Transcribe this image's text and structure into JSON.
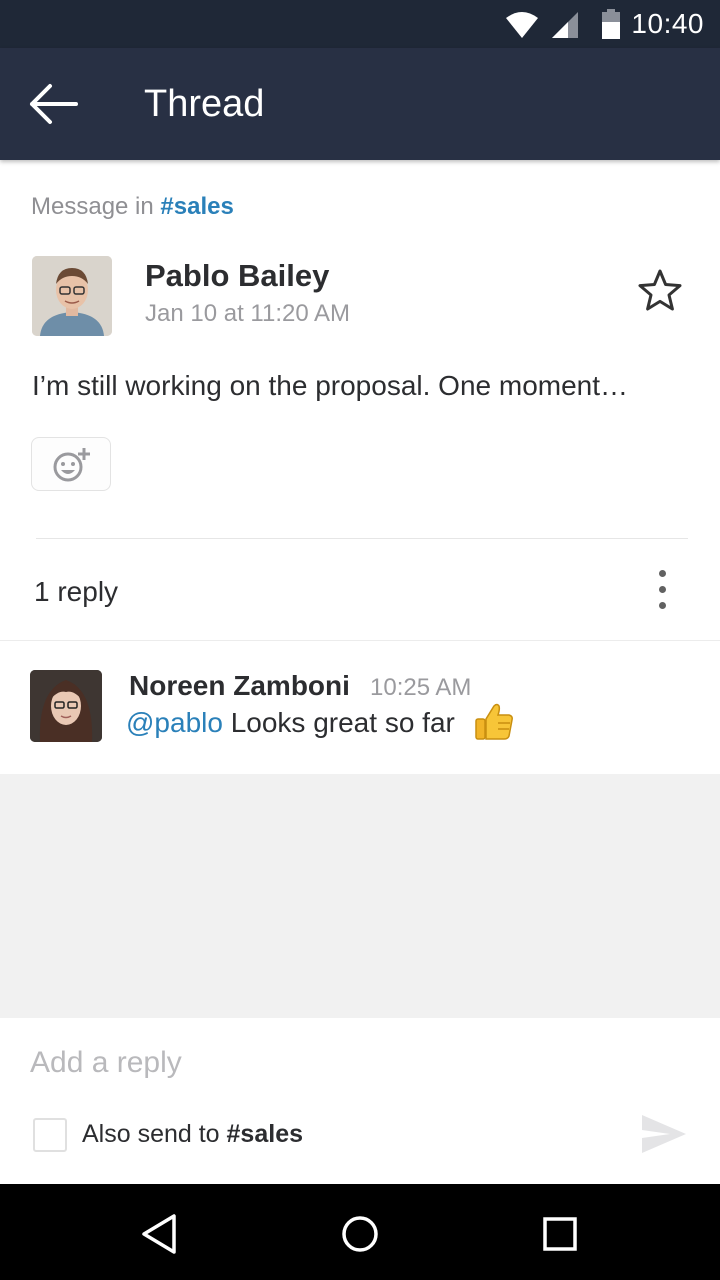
{
  "status_bar": {
    "time": "10:40",
    "icons": [
      "wifi-icon",
      "signal-icon",
      "battery-icon"
    ]
  },
  "app_bar": {
    "title": "Thread",
    "back_icon": "back-arrow-icon"
  },
  "parent_message": {
    "context_prefix": "Message in ",
    "channel": "#sales",
    "author": "Pablo Bailey",
    "timestamp": "Jan 10 at 11:20 AM",
    "text": "I’m still working on the proposal. One moment…",
    "star_icon": "star-icon",
    "reaction_icon": "add-reaction-icon"
  },
  "thread": {
    "reply_count": "1 reply",
    "more_icon": "more-vertical-icon"
  },
  "replies": [
    {
      "author": "Noreen Zamboni",
      "timestamp": "10:25 AM",
      "mention": "@pablo",
      "text": " Looks great so far",
      "emoji": "thumbs-up-icon"
    }
  ],
  "composer": {
    "placeholder": "Add a reply",
    "also_send_prefix": "Also send to ",
    "also_send_channel": "#sales",
    "send_icon": "send-icon"
  },
  "nav_bar": {
    "icons": [
      "back-triangle-icon",
      "home-circle-icon",
      "recents-square-icon"
    ]
  },
  "colors": {
    "status_bar": "#1f2837",
    "app_bar": "#283044",
    "link": "#2a80b9",
    "empty_area": "#f1f1f1"
  }
}
